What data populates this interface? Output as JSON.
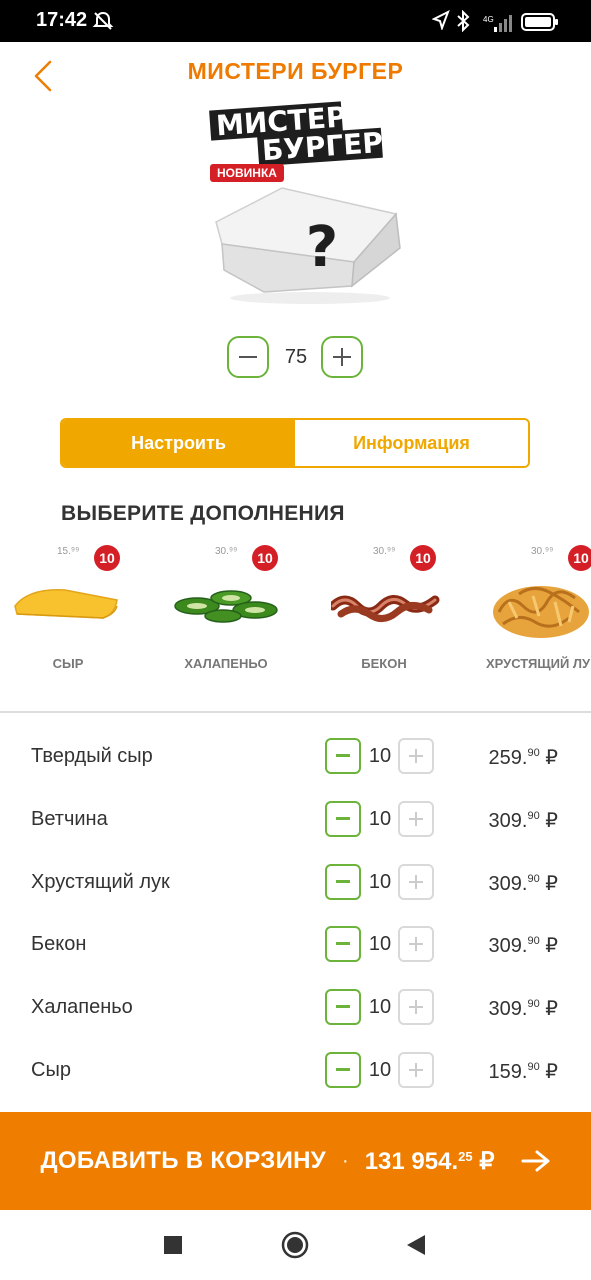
{
  "status_bar": {
    "time": "17:42",
    "network": "4G"
  },
  "header": {
    "title": "МИСТЕРИ БУРГЕР"
  },
  "product": {
    "logo_line1": "МИСТЕРИ",
    "logo_line2": "БУРГЕР",
    "badge": "НОВИНКА",
    "quantity": "75"
  },
  "tabs": [
    {
      "label": "Настроить",
      "active": true
    },
    {
      "label": "Информация",
      "active": false
    }
  ],
  "addons_title": "ВЫБЕРИТЕ ДОПОЛНЕНИЯ",
  "addons": [
    {
      "name": "СЫР",
      "price": "15.⁹⁹",
      "count": "10"
    },
    {
      "name": "ХАЛАПЕНЬО",
      "price": "30.⁹⁹",
      "count": "10"
    },
    {
      "name": "БЕКОН",
      "price": "30.⁹⁹",
      "count": "10"
    },
    {
      "name": "ХРУСТЯЩИЙ ЛУК",
      "price": "30.⁹⁹",
      "count": "10"
    }
  ],
  "items": [
    {
      "name": "Твердый сыр",
      "qty": "10",
      "price_int": "259.",
      "price_dec": "90",
      "currency": "₽"
    },
    {
      "name": "Ветчина",
      "qty": "10",
      "price_int": "309.",
      "price_dec": "90",
      "currency": "₽"
    },
    {
      "name": "Хрустящий лук",
      "qty": "10",
      "price_int": "309.",
      "price_dec": "90",
      "currency": "₽"
    },
    {
      "name": "Бекон",
      "qty": "10",
      "price_int": "309.",
      "price_dec": "90",
      "currency": "₽"
    },
    {
      "name": "Халапеньо",
      "qty": "10",
      "price_int": "309.",
      "price_dec": "90",
      "currency": "₽"
    },
    {
      "name": "Сыр",
      "qty": "10",
      "price_int": "159.",
      "price_dec": "90",
      "currency": "₽"
    }
  ],
  "cart_button": {
    "label": "ДОБАВИТЬ В КОРЗИНУ",
    "separator": "·",
    "total_int": "131 954.",
    "total_dec": "25",
    "currency": "₽"
  },
  "colors": {
    "accent": "#ef7d00",
    "tab": "#f0a800",
    "green": "#6bb33a",
    "badge": "#d51f26"
  }
}
